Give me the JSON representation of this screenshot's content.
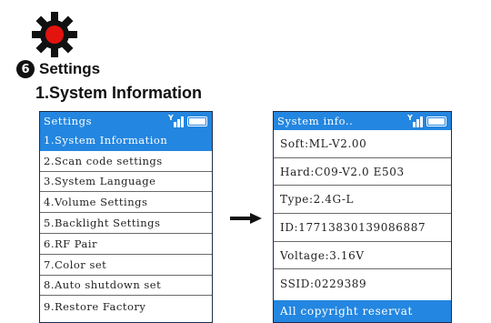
{
  "section": {
    "number": "6",
    "title": "Settings",
    "subtitle": "1.System Information"
  },
  "colors": {
    "accent": "#2386e0",
    "gear": "#e3130f",
    "border": "#1f2c4a"
  },
  "settings_screen": {
    "title": "Settings",
    "menu": [
      {
        "label": "1.System Information",
        "selected": true
      },
      {
        "label": "2.Scan code settings"
      },
      {
        "label": "3.System Language"
      },
      {
        "label": "4.Volume Settings"
      },
      {
        "label": "5.Backlight Settings"
      },
      {
        "label": "6.RF Pair"
      },
      {
        "label": "7.Color set"
      },
      {
        "label": "8.Auto shutdown set"
      },
      {
        "label": "9.Restore Factory"
      }
    ]
  },
  "info_screen": {
    "title": "System info..",
    "rows": [
      {
        "label": "Soft:ML-V2.00"
      },
      {
        "label": "Hard:C09-V2.0 E503"
      },
      {
        "label": "Type:2.4G-L"
      },
      {
        "label": "ID:17713830139086887"
      },
      {
        "label": "Voltage:3.16V"
      },
      {
        "label": "SSID:0229389"
      }
    ],
    "footer": "All copyright reservat"
  },
  "icons": {
    "section_icon": "gear-icon",
    "signal": "signal-strength-icon",
    "battery": "battery-icon",
    "navigation": "arrow-right-icon"
  }
}
